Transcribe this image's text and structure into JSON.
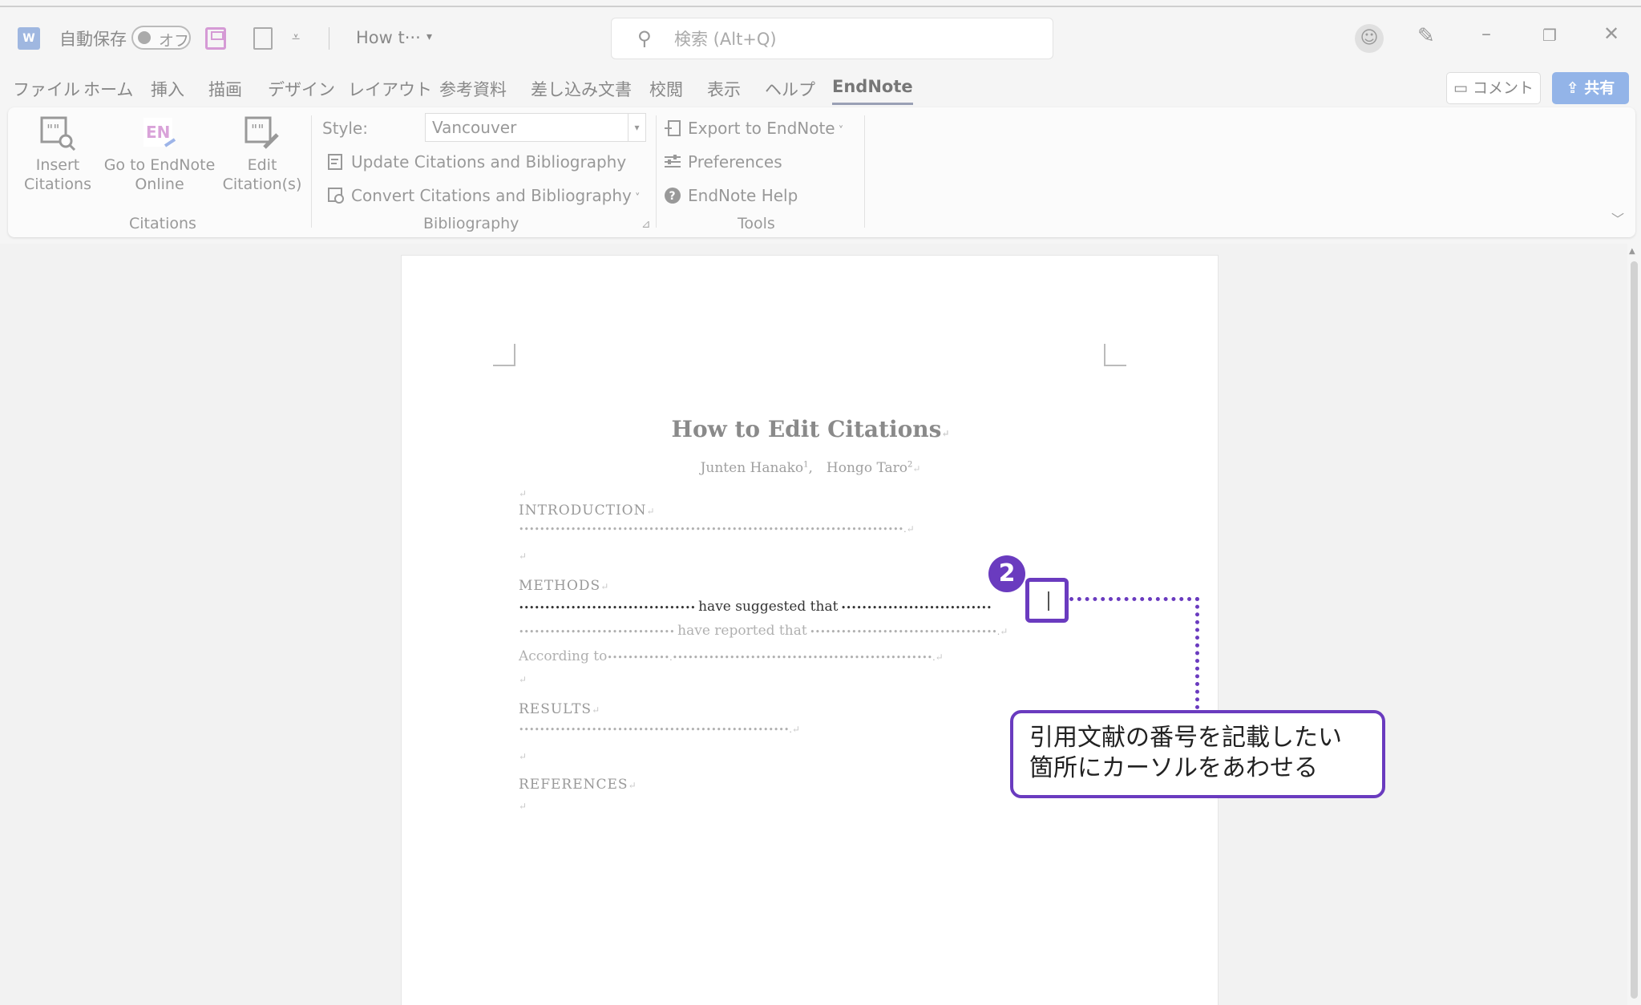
{
  "titlebar": {
    "app_icon_letter": "W",
    "autosave_label": "自動保存",
    "autosave_state": "オフ",
    "doc_name": "How t···",
    "search_placeholder": "検索 (Alt+Q)"
  },
  "menu_tabs": [
    {
      "label": "ファイル"
    },
    {
      "label": "ホーム"
    },
    {
      "label": "挿入"
    },
    {
      "label": "描画"
    },
    {
      "label": "デザイン"
    },
    {
      "label": "レイアウト"
    },
    {
      "label": "参考資料"
    },
    {
      "label": "差し込み文書"
    },
    {
      "label": "校閲"
    },
    {
      "label": "表示"
    },
    {
      "label": "ヘルプ"
    },
    {
      "label": "EndNote"
    }
  ],
  "actions": {
    "comment": "コメント",
    "share": "共有"
  },
  "ribbon": {
    "citations": {
      "group_label": "Citations",
      "insert": [
        "Insert",
        "Citations"
      ],
      "online": [
        "Go to EndNote",
        "Online"
      ],
      "edit": [
        "Edit",
        "Citation(s)"
      ]
    },
    "bibliography": {
      "group_label": "Bibliography",
      "style_label": "Style:",
      "style_value": "Vancouver",
      "update": "Update Citations and Bibliography",
      "convert": "Convert Citations and Bibliography"
    },
    "tools": {
      "group_label": "Tools",
      "export": "Export to EndNote",
      "preferences": "Preferences",
      "help": "EndNote Help"
    }
  },
  "document": {
    "title": "How to Edit Citations",
    "authors": "Junten Hanako",
    "author1_sup": "1",
    "author2": "Hongo Taro",
    "author2_sup": "2",
    "intro_heading": "INTRODUCTION",
    "intro_body": "••••••••••••••••••••••••••••••••••••••••••••••••••••••••••••••••••••••••••.",
    "methods_heading": "METHODS",
    "methods_line1_a": "•••••••••••••••••••••••••••••••••• ",
    "methods_line1_b": "have suggested that",
    "methods_line1_c": " •••••••••••••••••••••••••••••",
    "methods_line2_a": "•••••••••••••••••••••••••••••• ",
    "methods_line2_b": "have reported that",
    "methods_line2_c": " ••••••••••••••••••••••••••••••••••••.",
    "methods_line3_a": "According to",
    "methods_line3_b": "••••••••••••.••••••••••••••••••••••••••••••••••••••••••••••••••.",
    "results_heading": "RESULTS",
    "results_body": "••••••••••••••••••••••••••••••••••••••••••••••••••••.",
    "references_heading": "REFERENCES"
  },
  "annotation": {
    "step": "2",
    "callout_line1": "引用文献の番号を記載したい",
    "callout_line2": "箇所にカーソルをあわせる"
  }
}
